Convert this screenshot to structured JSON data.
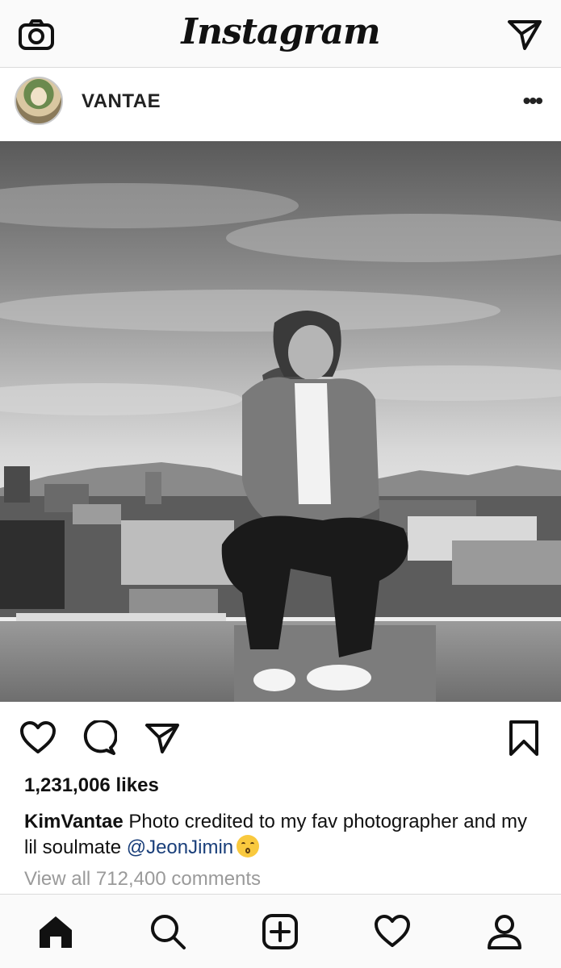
{
  "app": {
    "title": "Instagram"
  },
  "topbar": {
    "camera_icon": "camera-icon",
    "direct_icon": "paper-plane-icon"
  },
  "post": {
    "username": "VANTAE",
    "more_icon": "ellipsis-icon",
    "more_label": "•••",
    "likes": "1,231,006 likes",
    "caption": {
      "author": "KimVantae",
      "text": " Photo credited to my fav photographer and my lil soulmate ",
      "mention": "@JeonJimin",
      "emoji": "kissing-face-emoji"
    },
    "view_comments": "View all 712,400 comments"
  },
  "actions": {
    "like_icon": "heart-icon",
    "comment_icon": "comment-bubble-icon",
    "share_icon": "paper-plane-icon",
    "save_icon": "bookmark-icon"
  },
  "tabbar": {
    "items": [
      "home-icon",
      "search-icon",
      "add-post-icon",
      "activity-heart-icon",
      "profile-icon"
    ]
  },
  "colors": {
    "mention": "#1a3f7a",
    "muted": "#9a9a9a",
    "bar_background": "#fafafa",
    "divider": "#dbdbdb"
  }
}
